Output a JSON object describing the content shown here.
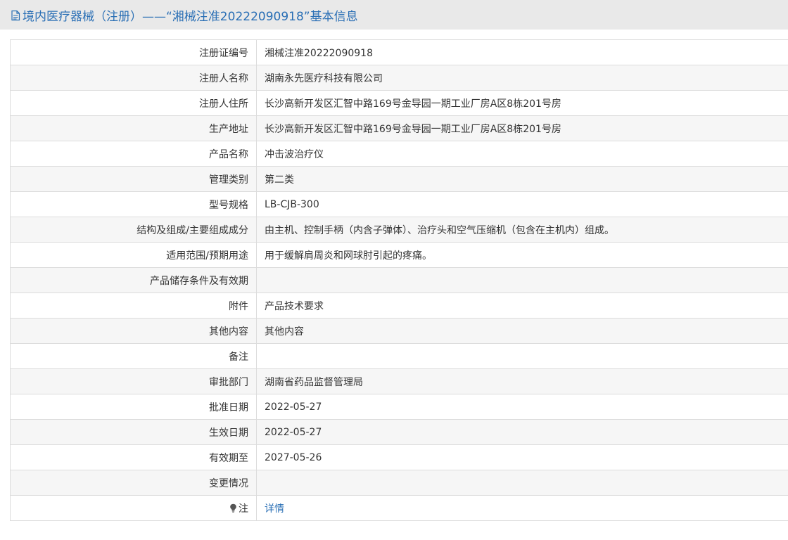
{
  "header": {
    "title": "境内医疗器械（注册）——“湘械注准20222090918”基本信息",
    "icon": "document-icon",
    "bg_color": "#e9e9e9",
    "title_color": "#2a6fb5"
  },
  "rows": [
    {
      "label": "注册证编号",
      "value": "湘械注准20222090918"
    },
    {
      "label": "注册人名称",
      "value": "湖南永先医疗科技有限公司"
    },
    {
      "label": "注册人住所",
      "value": "长沙高新开发区汇智中路169号金导园一期工业厂房A区8栋201号房"
    },
    {
      "label": "生产地址",
      "value": "长沙高新开发区汇智中路169号金导园一期工业厂房A区8栋201号房"
    },
    {
      "label": "产品名称",
      "value": "冲击波治疗仪"
    },
    {
      "label": "管理类别",
      "value": "第二类"
    },
    {
      "label": "型号规格",
      "value": "LB-CJB-300"
    },
    {
      "label": "结构及组成/主要组成成分",
      "value": "由主机、控制手柄（内含子弹体）、治疗头和空气压缩机（包含在主机内）组成。"
    },
    {
      "label": "适用范围/预期用途",
      "value": "用于缓解肩周炎和网球肘引起的疼痛。"
    },
    {
      "label": "产品储存条件及有效期",
      "value": ""
    },
    {
      "label": "附件",
      "value": "产品技术要求"
    },
    {
      "label": "其他内容",
      "value": "其他内容"
    },
    {
      "label": "备注",
      "value": ""
    },
    {
      "label": "审批部门",
      "value": "湖南省药品监督管理局"
    },
    {
      "label": "批准日期",
      "value": "2022-05-27"
    },
    {
      "label": "生效日期",
      "value": "2022-05-27"
    },
    {
      "label": "有效期至",
      "value": "2027-05-26"
    },
    {
      "label": "变更情况",
      "value": ""
    }
  ],
  "note": {
    "label": "注",
    "icon": "lightbulb-icon",
    "link_text": "详情",
    "link_color": "#2a6fb5"
  }
}
